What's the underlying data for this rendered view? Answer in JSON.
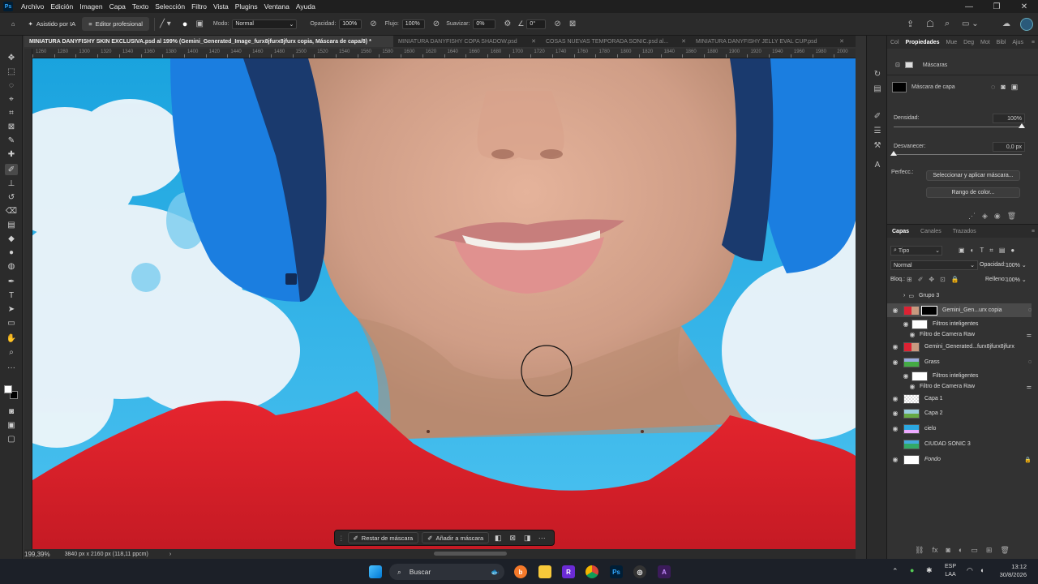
{
  "app": {
    "logo": "Ps",
    "menu": [
      "Archivo",
      "Edición",
      "Imagen",
      "Capa",
      "Texto",
      "Selección",
      "Filtro",
      "Vista",
      "Plugins",
      "Ventana",
      "Ayuda"
    ],
    "window_controls": [
      "—",
      "❐",
      "✕"
    ]
  },
  "options": {
    "home_icon": "home-icon",
    "assisted_label": "Asistido por IA",
    "pro_label": "Editor profesional",
    "mode_label": "Modo:",
    "mode_value": "Normal",
    "opacity_label": "Opacidad:",
    "opacity_value": "100%",
    "flow_label": "Flujo:",
    "flow_value": "100%",
    "smooth_label": "Suavizar:",
    "smooth_value": "0%",
    "angle_value": "0°"
  },
  "tabs": [
    {
      "label": "MINIATURA DANYFISHY SKIN EXCLUSIVA.psd al 199% (Gemini_Generated_Image_furx8jfurx8jfurx copia, Máscara de capa/8) *",
      "active": true
    },
    {
      "label": "MINIATURA DANYFISHY COPA SHADOW.psd",
      "active": false
    },
    {
      "label": "COSAS NUEVAS TEMPORADA SONIC.psd al...",
      "active": false
    },
    {
      "label": "MINIATURA DANYFISHY JELLY EVAL CUP.psd",
      "active": false
    }
  ],
  "ruler_ticks": [
    "1260",
    "1280",
    "1300",
    "1320",
    "1340",
    "1360",
    "1380",
    "1400",
    "1420",
    "1440",
    "1460",
    "1480",
    "1500",
    "1520",
    "1540",
    "1560",
    "1580",
    "1600",
    "1620",
    "1640",
    "1660",
    "1680",
    "1700",
    "1720",
    "1740",
    "1760",
    "1780",
    "1800",
    "1820",
    "1840",
    "1860",
    "1880",
    "1900",
    "1920",
    "1940",
    "1960",
    "1980",
    "2000"
  ],
  "status": {
    "zoom": "199,39%",
    "doc_size": "3840 px x 2160 px (118,11 ppcm)"
  },
  "context_bar": {
    "subtract_label": "Restar de máscara",
    "add_label": "Añadir a máscara",
    "more": "···"
  },
  "properties": {
    "tabs": [
      "Col",
      "Propiedades",
      "Mue",
      "Deg",
      "Mot",
      "Bibl",
      "Ajus"
    ],
    "active_tab": "Propiedades",
    "section": "Máscaras",
    "mask_label": "Máscara de capa",
    "density_label": "Densidad:",
    "density_value": "100%",
    "density_level": 1.0,
    "feather_label": "Desvanecer:",
    "feather_value": "0,0 px",
    "feather_level": 0.0,
    "refine_label": "Perfecc.:",
    "select_mask_btn": "Seleccionar y aplicar máscara...",
    "color_range_btn": "Rango de color..."
  },
  "layers": {
    "tabs": [
      "Capas",
      "Canales",
      "Trazados"
    ],
    "active_tab": "Capas",
    "kind_label": "Tipo",
    "blend": "Normal",
    "opacity_label": "Opacidad:",
    "opacity_value": "100%",
    "lock_label": "Bloq.:",
    "fill_label": "Relleno:",
    "fill_value": "100%",
    "items": [
      {
        "name": "Grupo 3",
        "type": "group",
        "visible": false
      },
      {
        "name": "Gemini_Gen...urx copia",
        "type": "smart",
        "visible": true,
        "selected": true
      },
      {
        "name": "Filtros inteligentes",
        "type": "filters",
        "visible": true
      },
      {
        "name": "Filtro de Camera Raw",
        "type": "filter",
        "visible": true
      },
      {
        "name": "Gemini_Generated...furx8jfurx8jfurx",
        "type": "smart",
        "visible": true
      },
      {
        "name": "Grass",
        "type": "smart",
        "visible": true
      },
      {
        "name": "Filtros inteligentes",
        "type": "filters",
        "visible": true
      },
      {
        "name": "Filtro de Camera Raw",
        "type": "filter",
        "visible": true
      },
      {
        "name": "Capa 1",
        "type": "pixel",
        "visible": true
      },
      {
        "name": "Capa 2",
        "type": "pixel",
        "visible": true
      },
      {
        "name": "cielo",
        "type": "pixel",
        "visible": true
      },
      {
        "name": "CIUDAD SONIC 3",
        "type": "pixel",
        "visible": false
      },
      {
        "name": "Fondo",
        "type": "background",
        "visible": true,
        "locked": true
      }
    ]
  },
  "taskbar": {
    "search_placeholder": "Buscar",
    "lang": "ESP",
    "lang2": "LAA",
    "time": "13:12",
    "date": "30/8/2026"
  },
  "colors": {
    "accent": "#31a8ff",
    "shirt": "#e0222c",
    "sky": "#2ba7e0",
    "headphone": "#1e7fe0"
  }
}
